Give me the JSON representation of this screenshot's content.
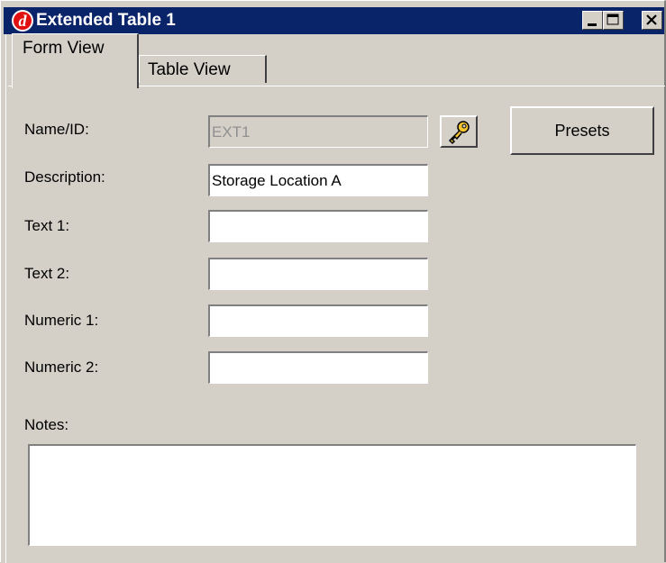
{
  "window": {
    "title": "Extended Table 1",
    "app_icon": "app-logo-icon",
    "controls": [
      "minimize-icon",
      "maximize-icon",
      "close-icon"
    ],
    "titlebar_color": "#0a246a"
  },
  "tabs": [
    {
      "label": "Form View",
      "selected": true
    },
    {
      "label": "Table View",
      "selected": false
    }
  ],
  "form": {
    "name_id": {
      "label": "Name/ID:",
      "value": "EXT1",
      "disabled": true
    },
    "key_button_icon": "key-icon",
    "presets_label": "Presets",
    "description": {
      "label": "Description:",
      "value": "Storage Location A"
    },
    "text1": {
      "label": "Text 1:",
      "value": ""
    },
    "text2": {
      "label": "Text 2:",
      "value": ""
    },
    "numeric1": {
      "label": "Numeric 1:",
      "value": ""
    },
    "numeric2": {
      "label": "Numeric 2:",
      "value": ""
    },
    "notes": {
      "label": "Notes:",
      "value": ""
    }
  }
}
